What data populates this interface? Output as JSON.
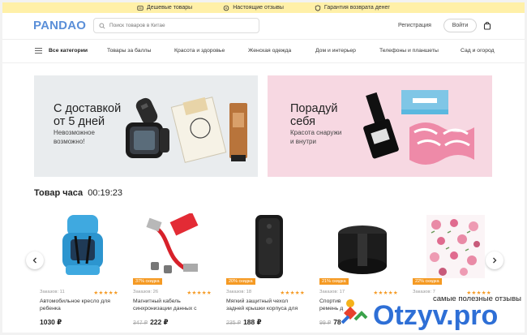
{
  "top_strip": {
    "items": [
      {
        "label": "Дешевые товары",
        "icon": "tag-icon"
      },
      {
        "label": "Настоящие отзывы",
        "icon": "chat-icon"
      },
      {
        "label": "Гарантия возврата денег",
        "icon": "shield-icon"
      }
    ]
  },
  "header": {
    "logo_text": "PANDAO",
    "search_placeholder": "Поиск товаров в Китае",
    "register_label": "Регистрация",
    "login_label": "Войти"
  },
  "nav": {
    "items": [
      "Все категории",
      "Товары за баллы",
      "Красота и здоровье",
      "Женская одежда",
      "Дом и интерьер",
      "Телефоны и планшеты",
      "Сад и огород"
    ]
  },
  "banners": [
    {
      "title_line1": "С доставкой",
      "title_line2": "от 5 дней",
      "sub_line1": "Невозможное",
      "sub_line2": "возможно!"
    },
    {
      "title_line1": "Порадуй",
      "title_line2": "себя",
      "sub_line1": "Красота снаружи",
      "sub_line2": "и внутри"
    }
  ],
  "section": {
    "title": "Товар часа",
    "timer": "00:19:23"
  },
  "products": [
    {
      "badge": "",
      "orders": "Заказов: 11",
      "stars": "★★★★★",
      "name_line1": "Автомобильное кресло для",
      "name_line2": "ребенка",
      "old_price": "",
      "price": "1030 ₽"
    },
    {
      "badge": "37% скидка",
      "orders": "Заказов: 26",
      "stars": "★★★★★",
      "name_line1": "Магнитный кабель",
      "name_line2": "синхронизации данных с",
      "old_price": "347 ₽",
      "price": "222 ₽"
    },
    {
      "badge": "20% скидка",
      "orders": "Заказов: 18",
      "stars": "★★★★★",
      "name_line1": "Мягкий защитный чехол",
      "name_line2": "задней крышки корпуса для",
      "old_price": "235 ₽",
      "price": "188 ₽"
    },
    {
      "badge": "21% скидка",
      "orders": "Заказов: 17",
      "stars": "★★★★★",
      "name_line1": "Спортив",
      "name_line2": "ремень д",
      "old_price": "99 ₽",
      "price": "78"
    },
    {
      "badge": "22% скидка",
      "orders": "Заказов: 7",
      "stars": "★★★★★",
      "name_line1": "",
      "name_line2": "",
      "old_price": "",
      "price": ""
    }
  ],
  "watermark": {
    "tagline": "самые полезные отзывы",
    "brand": "Otzyv.pro"
  },
  "colors": {
    "top_strip_bg": "#fff0a8",
    "logo_blue": "#5b8fd8",
    "logo_orange": "#f2a93b",
    "badge_orange": "#f59a23",
    "banner1_bg": "#e9ecee",
    "banner2_bg": "#f7d8e2",
    "watermark_blue": "#2e6fd6"
  }
}
